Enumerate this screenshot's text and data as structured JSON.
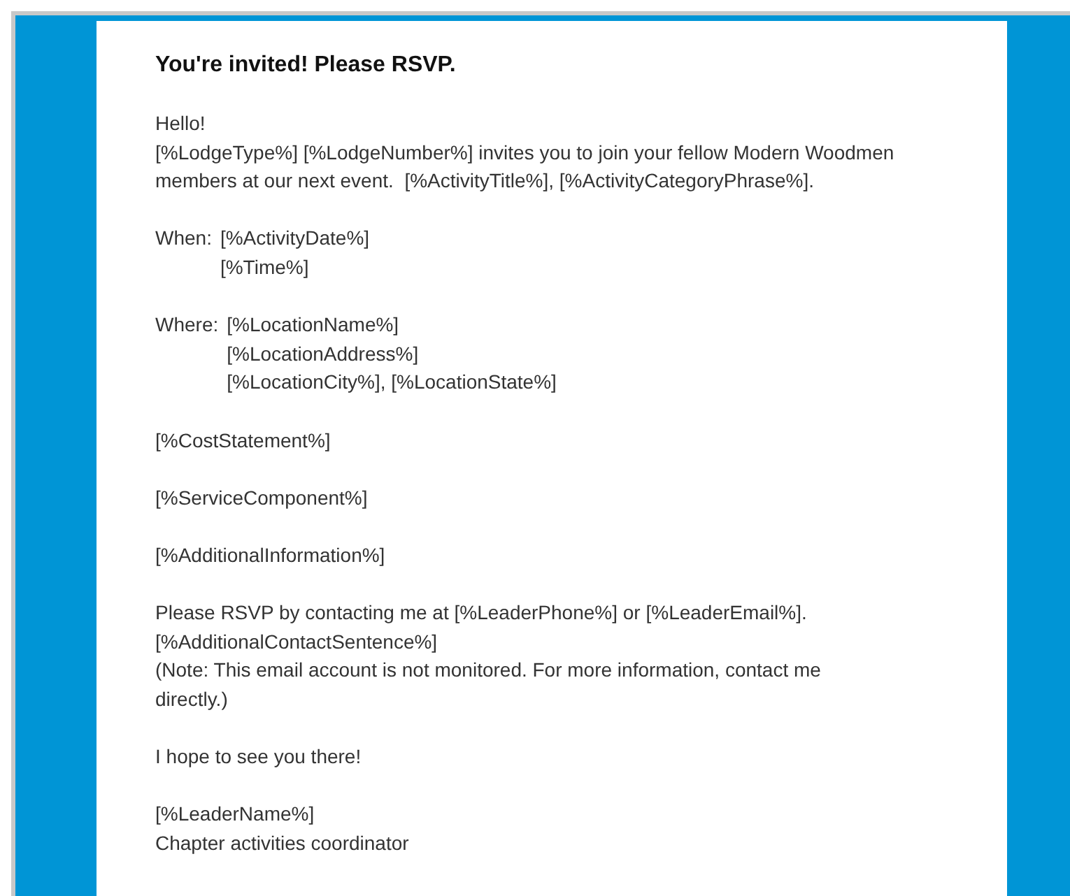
{
  "email": {
    "title": "You're invited! Please RSVP.",
    "blocks": [
      {
        "kind": "text",
        "lines": [
          "Hello!",
          "[%LodgeType%] [%LodgeNumber%] invites you to join your fellow Modern Woodmen members at our next event.  [%ActivityTitle%], [%ActivityCategoryPhrase%]."
        ]
      },
      {
        "kind": "detail",
        "label": "When:",
        "lines": [
          "[%ActivityDate%]",
          "[%Time%]"
        ]
      },
      {
        "kind": "detail",
        "label": "Where:",
        "lines": [
          "[%LocationName%]",
          "[%LocationAddress%]",
          "[%LocationCity%], [%LocationState%]"
        ]
      },
      {
        "kind": "text",
        "lines": [
          "[%CostStatement%]"
        ]
      },
      {
        "kind": "text",
        "lines": [
          "[%ServiceComponent%]"
        ]
      },
      {
        "kind": "text",
        "lines": [
          "[%AdditionalInformation%]"
        ]
      },
      {
        "kind": "text",
        "lines": [
          "Please RSVP by contacting me at [%LeaderPhone%] or [%LeaderEmail%].",
          "[%AdditionalContactSentence%]",
          "(Note: This email account is not monitored. For more information, contact me directly.)"
        ]
      },
      {
        "kind": "text",
        "lines": [
          "I hope to see you there!"
        ]
      },
      {
        "kind": "text",
        "lines": [
          "[%LeaderName%]",
          "Chapter activities coordinator"
        ]
      }
    ]
  }
}
